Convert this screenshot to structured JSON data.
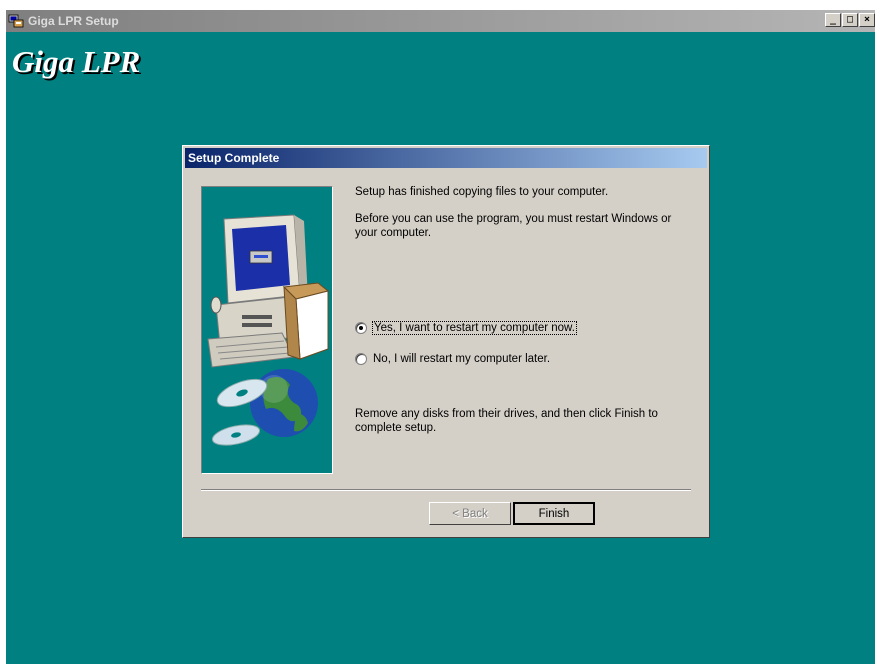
{
  "window": {
    "title": "Giga LPR Setup",
    "banner": "Giga LPR",
    "controls": {
      "minimize": "_",
      "maximize": "□",
      "close": "×"
    }
  },
  "dialog": {
    "title": "Setup Complete",
    "message1": "Setup has finished copying files to your computer.",
    "message2": "Before you can use the program, you must restart Windows or your computer.",
    "options": [
      {
        "label": "Yes, I want to restart my computer now.",
        "selected": true
      },
      {
        "label": "No, I will restart my computer later.",
        "selected": false
      }
    ],
    "message3": "Remove any disks from their drives, and then click Finish to complete setup.",
    "buttons": {
      "back": "< Back",
      "finish": "Finish"
    }
  },
  "colors": {
    "desktop": "#008080",
    "titlebar_active": "#0a246a",
    "face": "#d4d0c8"
  },
  "icons": [
    "setup-app-icon",
    "computer-illustration-icon",
    "globe-cd-illustration-icon"
  ]
}
